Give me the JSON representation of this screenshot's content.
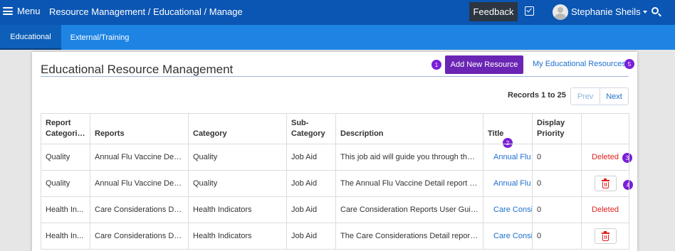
{
  "header": {
    "menu_label": "Menu",
    "breadcrumb": "Resource Management / Educational / Manage",
    "feedback_label": "Feedback",
    "user_name": "Stephanie Sheils"
  },
  "tabs": [
    {
      "label": "Educational",
      "active": true
    },
    {
      "label": "External/Training",
      "active": false
    }
  ],
  "page": {
    "title": "Educational Resource Management",
    "add_button": "Add New Resource",
    "my_resources_link": "My Educational Resources",
    "records_label": "Records 1 to 25",
    "prev_label": "Prev",
    "next_label": "Next"
  },
  "badges": [
    "1",
    "2",
    "3",
    "4",
    "5"
  ],
  "table": {
    "headers": {
      "report_categories": "Report Categories",
      "reports": "Reports",
      "category": "Category",
      "sub_category": "Sub-Category",
      "description": "Description",
      "title": "Title",
      "display_priority": "Display Priority"
    },
    "rows": [
      {
        "report_category": "Quality",
        "report": "Annual Flu Vaccine Detail",
        "category": "Quality",
        "sub_category": "Job Aid",
        "description": "This job aid will guide you through the ...",
        "title": "Annual Flu",
        "priority": "0",
        "status": "Deleted"
      },
      {
        "report_category": "Quality",
        "report": "Annual Flu Vaccine Detail",
        "category": "Quality",
        "sub_category": "Job Aid",
        "description": "The Annual Flu Vaccine Detail report pr...",
        "title": "Annual Flu",
        "priority": "0",
        "status": ""
      },
      {
        "report_category": "Health In...",
        "report": "Care Considerations De...",
        "category": "Health Indicators",
        "sub_category": "Job Aid",
        "description": "Care Consideration Reports User Guide",
        "title": "Care Consi",
        "priority": "0",
        "status": "Deleted"
      },
      {
        "report_category": "Health In...",
        "report": "Care Considerations De...",
        "category": "Health Indicators",
        "sub_category": "Job Aid",
        "description": "The Care Considerations Detail report ...",
        "title": "Care Consi",
        "priority": "0",
        "status": ""
      }
    ]
  },
  "colors": {
    "topbar": "#0b56b3",
    "tabbar": "#1e84e4",
    "primary_button": "#6a25b4",
    "badge": "#7a1fd6",
    "link": "#1e6fd0",
    "danger": "#e02020"
  },
  "icons": [
    "hamburger-icon",
    "checkbox-icon",
    "avatar",
    "chevron-down-icon",
    "search-icon",
    "trash-icon"
  ]
}
